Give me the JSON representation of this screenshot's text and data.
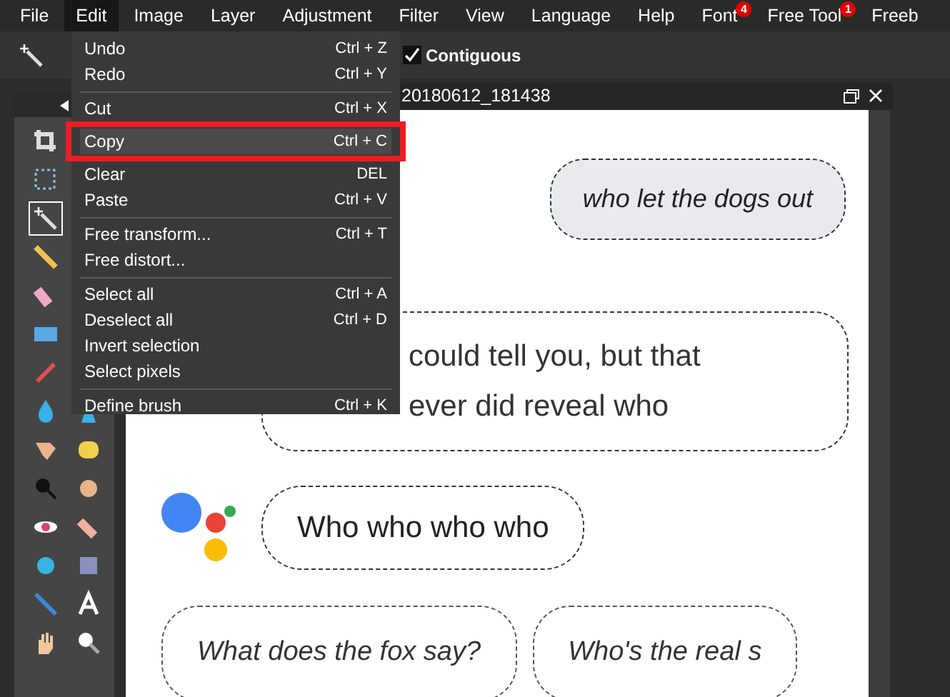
{
  "menubar": [
    {
      "label": "File",
      "selected": false
    },
    {
      "label": "Edit",
      "selected": true
    },
    {
      "label": "Image",
      "selected": false
    },
    {
      "label": "Layer",
      "selected": false
    },
    {
      "label": "Adjustment",
      "selected": false
    },
    {
      "label": "Filter",
      "selected": false
    },
    {
      "label": "View",
      "selected": false
    },
    {
      "label": "Language",
      "selected": false
    },
    {
      "label": "Help",
      "selected": false
    },
    {
      "label": "Font",
      "selected": false,
      "badge": "4"
    },
    {
      "label": "Free Tool",
      "selected": false,
      "badge": "1"
    },
    {
      "label": "Freeb",
      "selected": false
    }
  ],
  "options_bar": {
    "contiguous": {
      "label": "Contiguous",
      "checked": true
    }
  },
  "edit_menu": [
    [
      {
        "label": "Undo",
        "shortcut": "Ctrl + Z",
        "highlighted": false
      },
      {
        "label": "Redo",
        "shortcut": "Ctrl + Y",
        "highlighted": false
      }
    ],
    [
      {
        "label": "Cut",
        "shortcut": "Ctrl + X",
        "highlighted": false
      },
      {
        "label": "Copy",
        "shortcut": "Ctrl + C",
        "highlighted": true
      },
      {
        "label": "Clear",
        "shortcut": "DEL",
        "highlighted": false
      },
      {
        "label": "Paste",
        "shortcut": "Ctrl + V",
        "highlighted": false
      }
    ],
    [
      {
        "label": "Free transform...",
        "shortcut": "Ctrl + T",
        "highlighted": false
      },
      {
        "label": "Free distort...",
        "highlighted": false
      }
    ],
    [
      {
        "label": "Select all",
        "shortcut": "Ctrl + A",
        "highlighted": false
      },
      {
        "label": "Deselect all",
        "shortcut": "Ctrl + D",
        "highlighted": false
      },
      {
        "label": "Invert selection",
        "highlighted": false
      },
      {
        "label": "Select pixels",
        "highlighted": false
      }
    ],
    [
      {
        "label": "Define brush",
        "shortcut": "Ctrl + K",
        "highlighted": false
      }
    ]
  ],
  "document": {
    "title": "20180612_181438",
    "user_message": "who let the dogs out",
    "reply_message_lines": [
      "could tell you, but that",
      "ever did reveal who"
    ],
    "reply_message_2": "Who who who who",
    "suggestions": [
      "What does the fox say?",
      "Who's the real s"
    ]
  }
}
